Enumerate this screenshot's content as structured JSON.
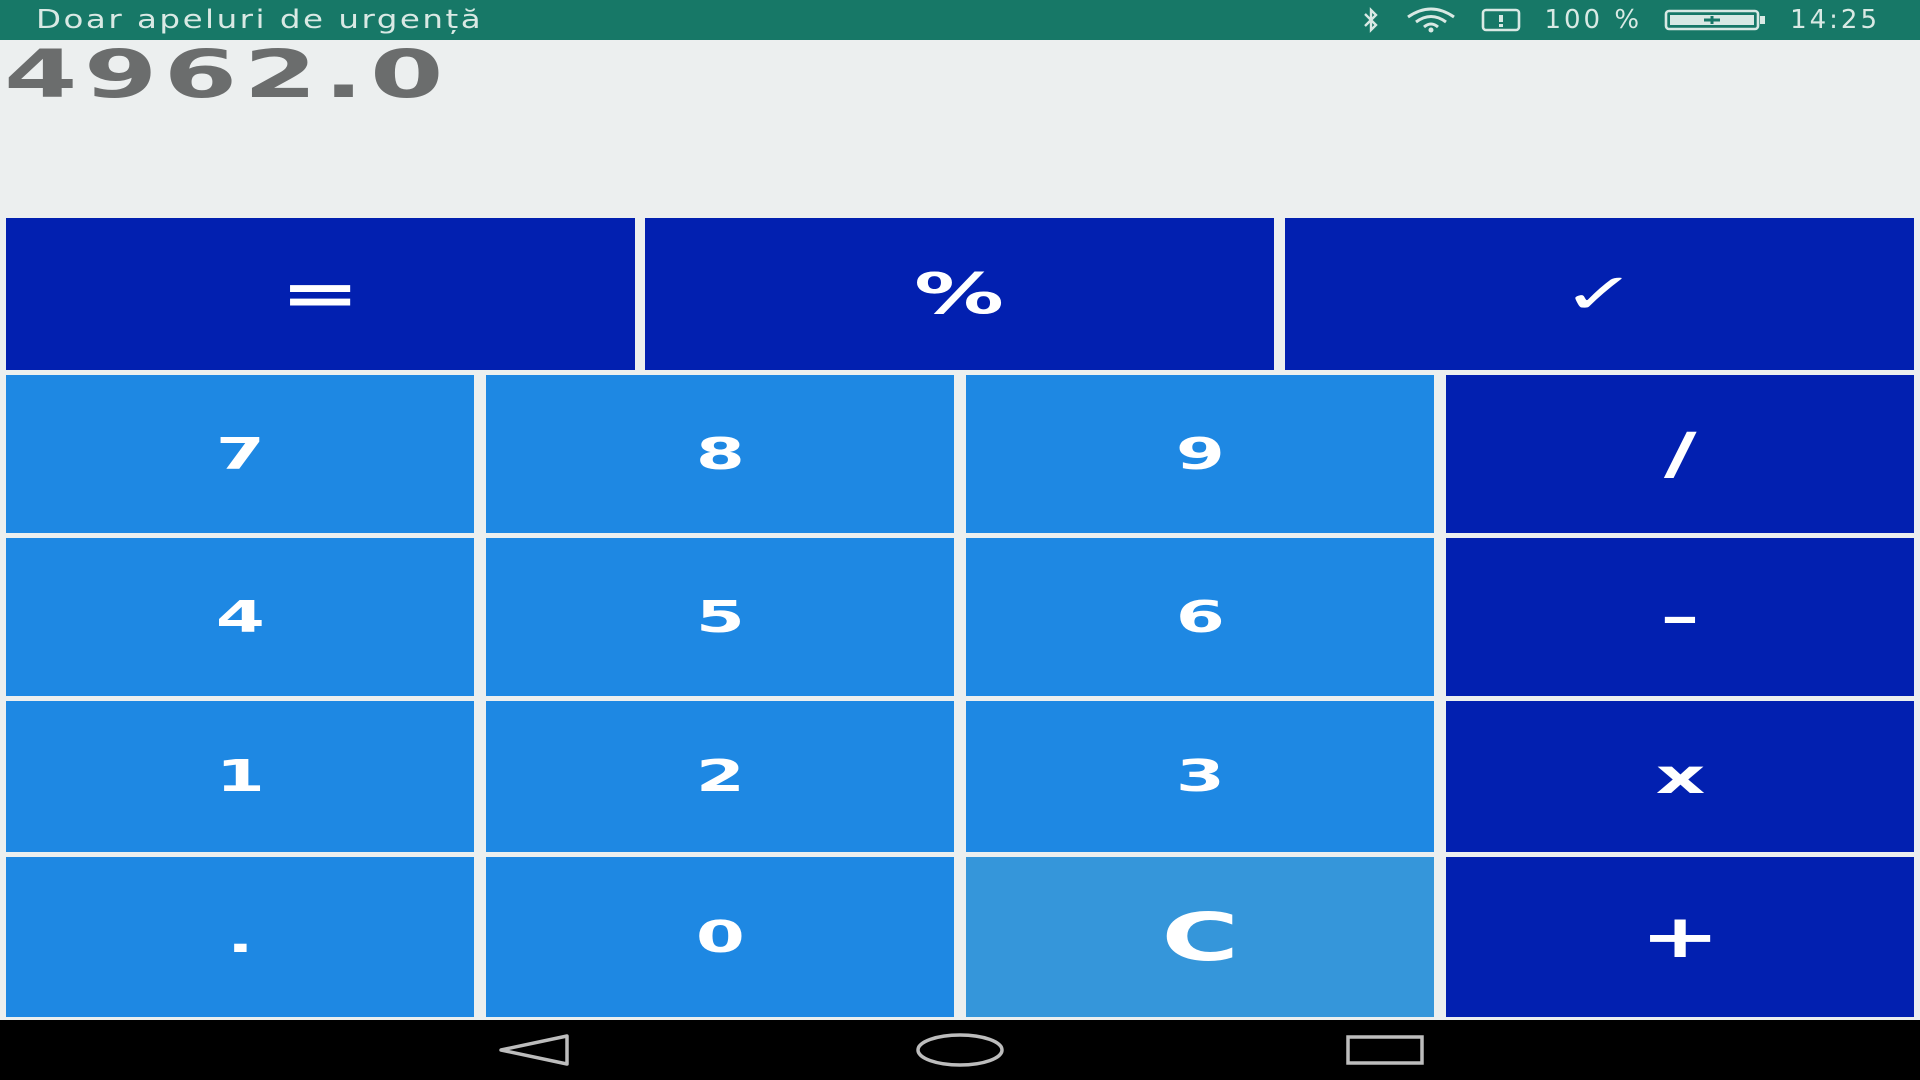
{
  "status_bar": {
    "carrier_text": "Doar apeluri de urgență",
    "battery_percent": "100 %",
    "time": "14:25",
    "icons": [
      "bluetooth-icon",
      "wifi-icon",
      "battery-saver-icon",
      "battery-icon"
    ]
  },
  "display": {
    "value": "4962.0"
  },
  "keys": {
    "equals": "=",
    "percent": "%",
    "check": "✓",
    "seven": "7",
    "eight": "8",
    "nine": "9",
    "divide": "/",
    "four": "4",
    "five": "5",
    "six": "6",
    "minus": "–",
    "one": "1",
    "two": "2",
    "three": "3",
    "multiply": "x",
    "dot": ".",
    "zero": "0",
    "clear": "C",
    "plus": "+"
  },
  "colors": {
    "status_bar": "#177867",
    "operator_key": "#0220b0",
    "digit_key": "#1e88e3",
    "clear_key": "#3596da",
    "display_bg": "#ecefef",
    "display_text": "#6b6d6d"
  },
  "nav_bar": {
    "icons": [
      "back-icon",
      "home-icon",
      "recents-icon"
    ]
  }
}
